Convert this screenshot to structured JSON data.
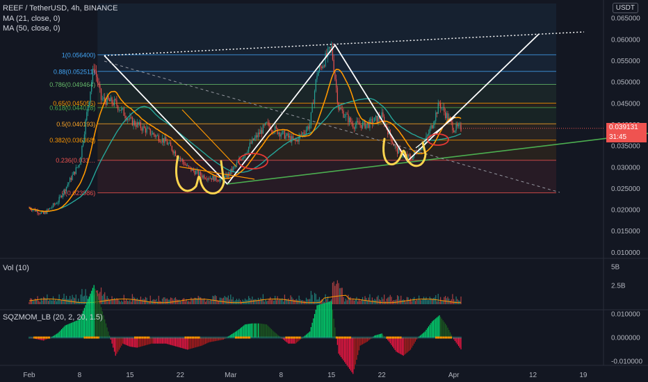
{
  "header": {
    "title": "REEF / TetherUSD, 4h, BINANCE",
    "ma1": "MA (21, close, 0)",
    "ma2": "MA (50, close, 0)",
    "currency": "USDT"
  },
  "price_tag": {
    "value": "0.039131",
    "countdown": "31:45",
    "color": "#ef5350"
  },
  "colors": {
    "background": "#131722",
    "ma21": "#ff9800",
    "ma50": "#26a69a",
    "candle_up": "#26a69a",
    "candle_down": "#ef5350",
    "trendline_green": "#4caf50",
    "annotation_white": "#ffffff",
    "annotation_yellow": "#ffd54f",
    "annotation_red": "#e53935"
  },
  "chart_data": [
    {
      "type": "candlestick",
      "title": "REEF / TetherUSD, 4h, BINANCE",
      "x_tick_labels": [
        "Feb",
        "8",
        "15",
        "22",
        "Mar",
        "8",
        "15",
        "22",
        "Apr",
        "12",
        "19"
      ],
      "y_tick_labels": [
        "0.065000",
        "0.060000",
        "0.055000",
        "0.050000",
        "0.045000",
        "0.040000",
        "0.035000",
        "0.030000",
        "0.025000",
        "0.020000",
        "0.015000",
        "0.010000"
      ],
      "ylim": [
        0.007,
        0.068
      ],
      "last_price": 0.039131,
      "close_path": [
        [
          "Feb 1",
          0.0205
        ],
        [
          "Feb 3",
          0.019
        ],
        [
          "Feb 5",
          0.022
        ],
        [
          "Feb 7",
          0.028
        ],
        [
          "Feb 8",
          0.031
        ],
        [
          "Feb 10",
          0.054
        ],
        [
          "Feb 11",
          0.046
        ],
        [
          "Feb 13",
          0.045
        ],
        [
          "Feb 15",
          0.041
        ],
        [
          "Feb 18",
          0.038
        ],
        [
          "Feb 20",
          0.036
        ],
        [
          "Feb 23",
          0.03
        ],
        [
          "Feb 25",
          0.028
        ],
        [
          "Feb 28",
          0.027
        ],
        [
          "Mar 2",
          0.031
        ],
        [
          "Mar 4",
          0.036
        ],
        [
          "Mar 6",
          0.04
        ],
        [
          "Mar 8",
          0.038
        ],
        [
          "Mar 10",
          0.036
        ],
        [
          "Mar 12",
          0.04
        ],
        [
          "Mar 13",
          0.052
        ],
        [
          "Mar 15",
          0.058
        ],
        [
          "Mar 16",
          0.044
        ],
        [
          "Mar 18",
          0.04
        ],
        [
          "Mar 20",
          0.04
        ],
        [
          "Mar 22",
          0.042
        ],
        [
          "Mar 24",
          0.034
        ],
        [
          "Mar 26",
          0.032
        ],
        [
          "Mar 28",
          0.036
        ],
        [
          "Mar 29",
          0.04
        ],
        [
          "Mar 30",
          0.045
        ],
        [
          "Apr 1",
          0.039131
        ]
      ],
      "fibonacci": [
        {
          "label": "1(0.056400)",
          "value": 0.0564,
          "color": "#42a5f5"
        },
        {
          "label": "0.88(0.052511)",
          "value": 0.052511,
          "color": "#42a5f5"
        },
        {
          "label": "0.786(0.049464)",
          "value": 0.049464,
          "color": "#66bb6a"
        },
        {
          "label": "0.65(0.045055)",
          "value": 0.045055,
          "color": "#ff9800"
        },
        {
          "label": "0.618(0.044018)",
          "value": 0.044018,
          "color": "#4caf50"
        },
        {
          "label": "0.5(0.040193)",
          "value": 0.040193,
          "color": "#ffa726"
        },
        {
          "label": "0.382(0.036368)",
          "value": 0.036368,
          "color": "#ff9800"
        },
        {
          "label": "0.236(0.031…",
          "value": 0.031636,
          "color": "#ef5350"
        },
        {
          "label": "0(0.023986)",
          "value": 0.023986,
          "color": "#ef5350"
        }
      ]
    },
    {
      "type": "bar",
      "title": "Vol (10)",
      "y_tick_labels": [
        "5B",
        "2.5B"
      ],
      "ylim": [
        0,
        5.2
      ]
    },
    {
      "type": "bar",
      "title": "SQZMOM_LB (20, 2, 20, 1.5)",
      "y_tick_labels": [
        "0.010000",
        "0.000000",
        "-0.010000"
      ],
      "ylim": [
        -0.0125,
        0.0125
      ]
    }
  ]
}
